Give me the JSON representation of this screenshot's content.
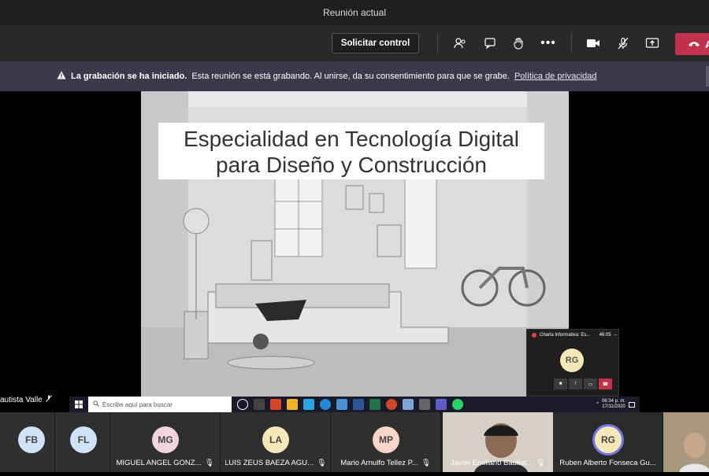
{
  "window": {
    "title": "Reunión actual"
  },
  "toolbar": {
    "request_control": "Solicitar control",
    "hangup_label": "A",
    "icons": [
      "people-icon",
      "chat-icon",
      "raise-hand-icon",
      "more-icon",
      "camera-icon",
      "mic-off-icon",
      "share-icon",
      "hangup-icon"
    ]
  },
  "banner": {
    "bold": "La grabación se ha iniciado.",
    "text": "Esta reunión se está grabando. Al unirse, da su consentimiento para que se grabe.",
    "link": "Política de privacidad"
  },
  "slide": {
    "title_line1": "Especialidad en Tecnología Digital",
    "title_line2": "para Diseño y Construcción"
  },
  "presenter_name": "autista Valle",
  "taskbar": {
    "search_placeholder": "Escribe aquí para buscar",
    "time": "06:34 p. m.",
    "date": "17/11/2020"
  },
  "mini_window": {
    "title": "Charla Informativa: Es...",
    "duration": "46:05",
    "initials": "RG"
  },
  "participants": [
    {
      "initials": "FB",
      "name": "",
      "color": "#cfe3f7"
    },
    {
      "initials": "FL",
      "name": "",
      "color": "#cfe3f7"
    },
    {
      "initials": "MG",
      "name": "MIGUEL ANGEL GONZ...",
      "color": "#f3d3dc"
    },
    {
      "initials": "LA",
      "name": "LUIS ZEUS BAEZA AGU...",
      "color": "#f5e7b8"
    },
    {
      "initials": "MP",
      "name": "Mario Arnulfo Tellez P...",
      "color": "#f7d6c9"
    },
    {
      "initials": "",
      "name": "Javier Emiliano Bautist...",
      "color": ""
    },
    {
      "initials": "RG",
      "name": "Ruben Alberto Fonseca Gu...",
      "color": "#f5e7b8"
    }
  ]
}
